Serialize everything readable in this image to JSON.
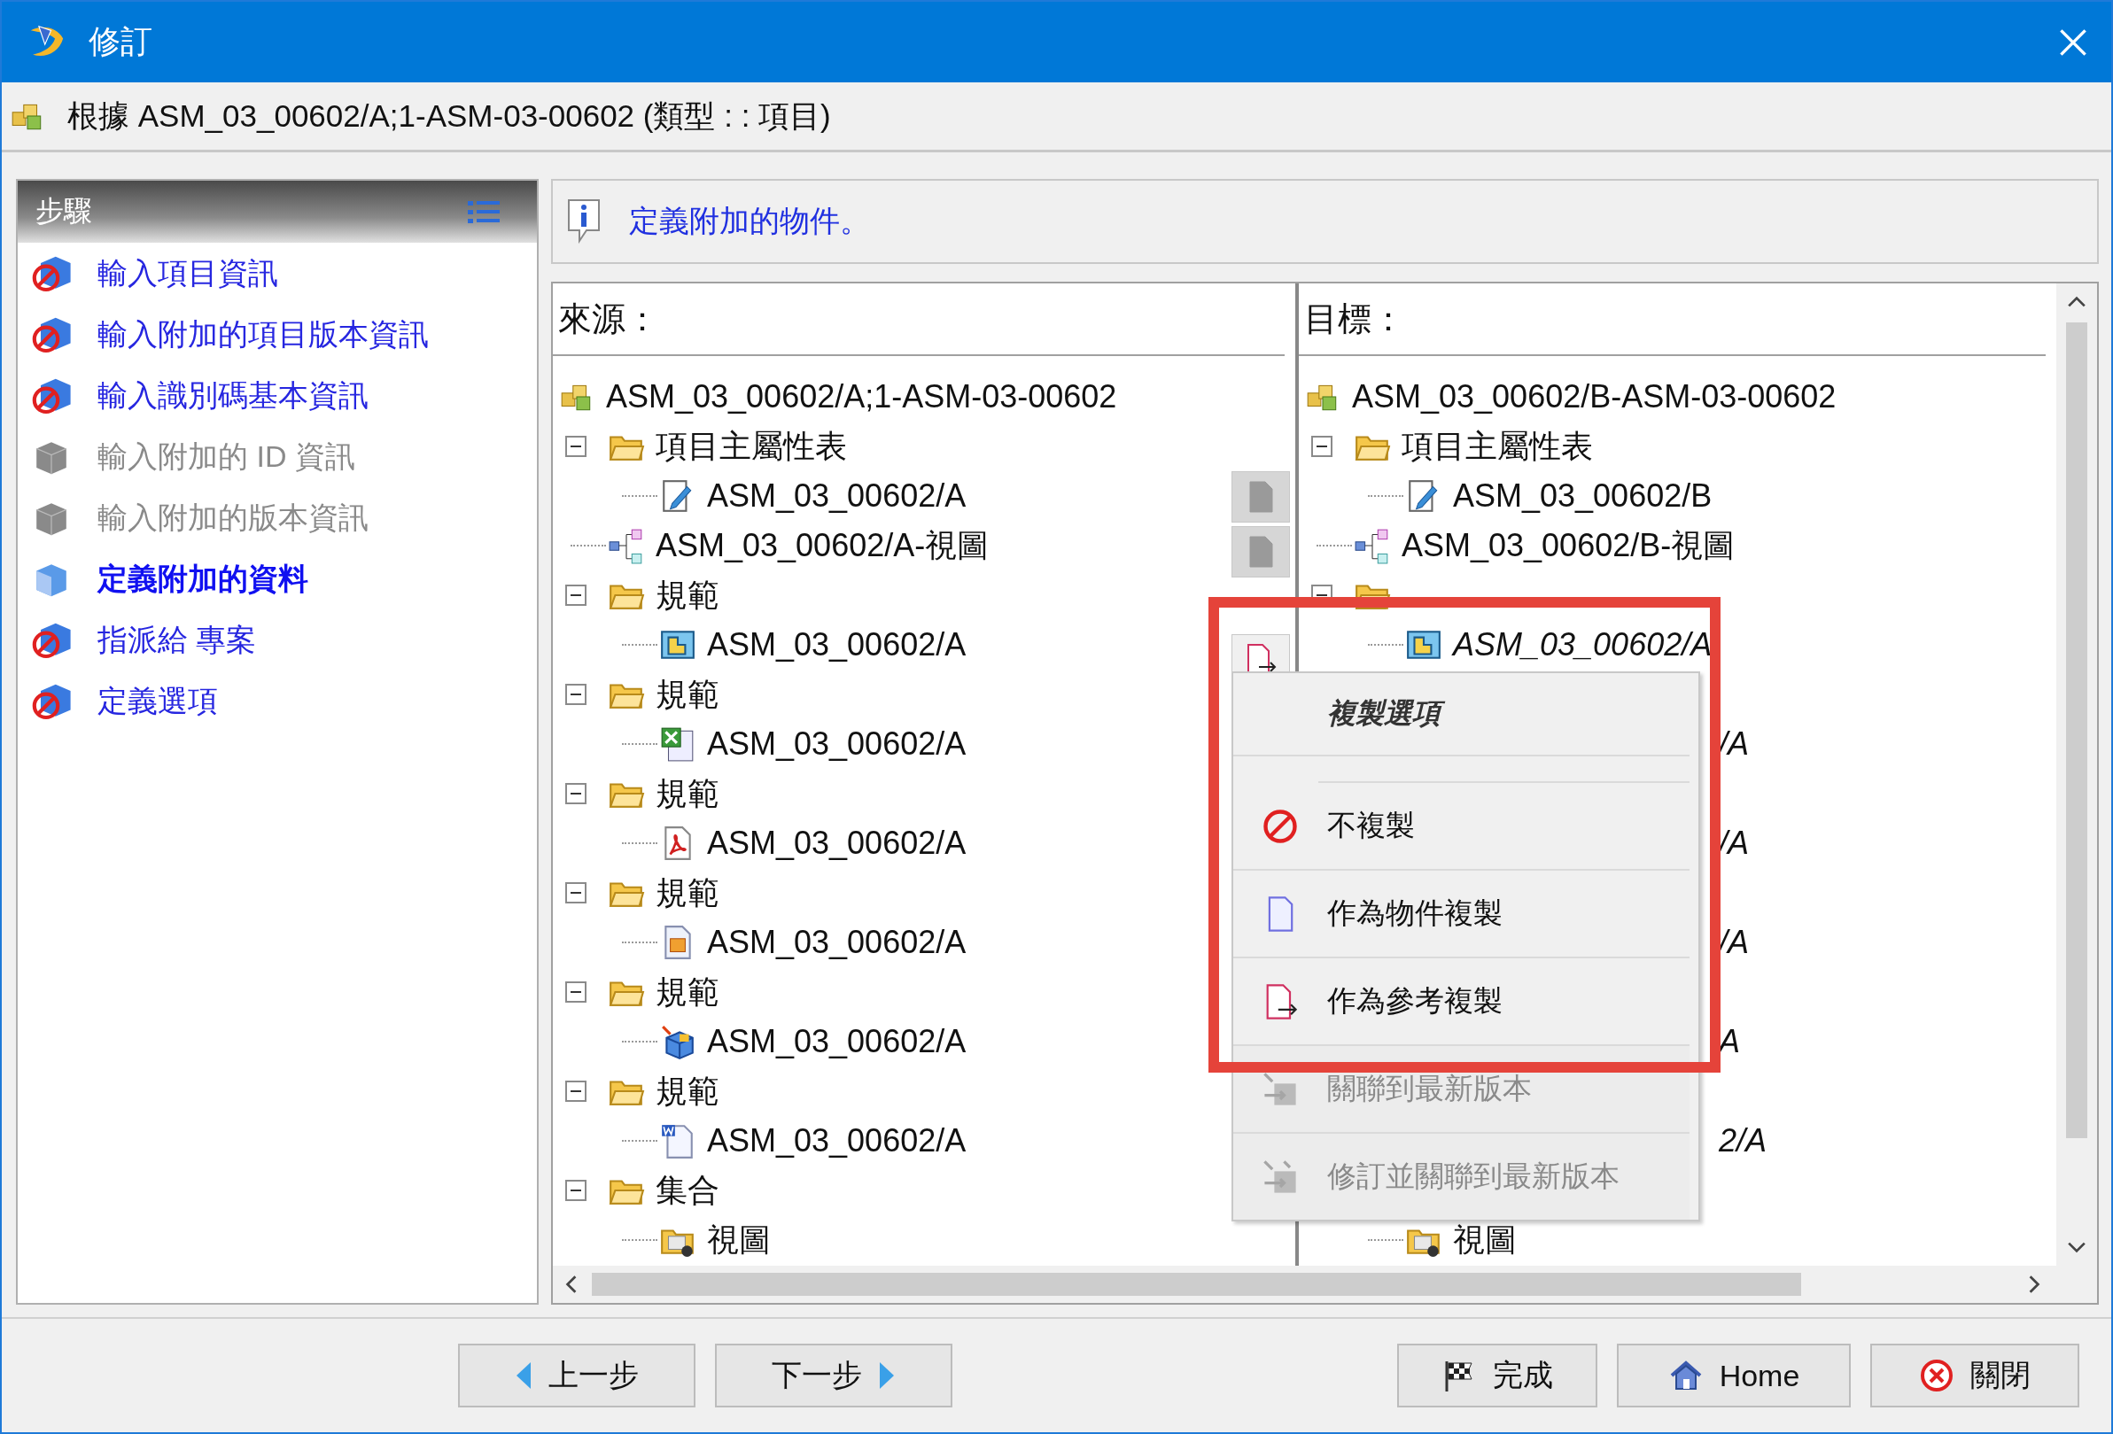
{
  "window": {
    "title": "修訂"
  },
  "subtitle": "根據 ASM_03_00602/A;1-ASM-03-00602 (類型 : : 項目)",
  "steps": {
    "title": "步驟",
    "items": [
      {
        "label": "輸入項目資訊",
        "disabled": false,
        "selected": false
      },
      {
        "label": "輸入附加的項目版本資訊",
        "disabled": false,
        "selected": false
      },
      {
        "label": "輸入識別碼基本資訊",
        "disabled": false,
        "selected": false
      },
      {
        "label": "輸入附加的 ID 資訊",
        "disabled": true,
        "selected": false
      },
      {
        "label": "輸入附加的版本資訊",
        "disabled": true,
        "selected": false
      },
      {
        "label": "定義附加的資料",
        "disabled": false,
        "selected": true
      },
      {
        "label": "指派給 專案",
        "disabled": false,
        "selected": false
      },
      {
        "label": "定義選項",
        "disabled": false,
        "selected": false
      }
    ]
  },
  "info": "定義附加的物件。",
  "source": {
    "title": "來源：",
    "tree": [
      {
        "label": "ASM_03_00602/A;1-ASM-03-00602",
        "kind": "assembly",
        "children": [
          {
            "label": "項目主屬性表",
            "kind": "folder",
            "expanded": true,
            "children": [
              {
                "label": "ASM_03_00602/A",
                "kind": "form"
              }
            ]
          },
          {
            "label": "ASM_03_00602/A-視圖",
            "kind": "view"
          },
          {
            "label": "規範",
            "kind": "folder",
            "expanded": true,
            "children": [
              {
                "label": "ASM_03_00602/A",
                "kind": "drawing"
              }
            ]
          },
          {
            "label": "規範",
            "kind": "folder",
            "expanded": true,
            "children": [
              {
                "label": "ASM_03_00602/A",
                "kind": "excel"
              }
            ]
          },
          {
            "label": "規範",
            "kind": "folder",
            "expanded": true,
            "children": [
              {
                "label": "ASM_03_00602/A",
                "kind": "pdf"
              }
            ]
          },
          {
            "label": "規範",
            "kind": "folder",
            "expanded": true,
            "children": [
              {
                "label": "ASM_03_00602/A",
                "kind": "image"
              }
            ]
          },
          {
            "label": "規範",
            "kind": "folder",
            "expanded": true,
            "children": [
              {
                "label": "ASM_03_00602/A",
                "kind": "part"
              }
            ]
          },
          {
            "label": "規範",
            "kind": "folder",
            "expanded": true,
            "children": [
              {
                "label": "ASM_03_00602/A",
                "kind": "word"
              }
            ]
          },
          {
            "label": "集合",
            "kind": "folder",
            "expanded": true,
            "children": [
              {
                "label": "視圖",
                "kind": "view-folder"
              }
            ]
          }
        ]
      }
    ]
  },
  "transfer_buttons": [
    {
      "kind": "document",
      "disabled": true
    },
    {
      "kind": "document",
      "disabled": true
    },
    {
      "kind": "reference",
      "disabled": false
    }
  ],
  "target": {
    "title": "目標：",
    "tree": [
      {
        "label": "ASM_03_00602/B-ASM-03-00602",
        "kind": "assembly",
        "children": [
          {
            "label": "項目主屬性表",
            "kind": "folder",
            "expanded": true,
            "children": [
              {
                "label": "ASM_03_00602/B",
                "kind": "form"
              }
            ]
          },
          {
            "label": "ASM_03_00602/B-視圖",
            "kind": "view"
          },
          {
            "kind": "folder",
            "expanded": true,
            "children": [
              {
                "label": "ASM_03_00602/A",
                "kind": "drawing",
                "italic": true
              }
            ]
          }
        ]
      }
    ],
    "covered_rows": [
      "/A",
      "/A",
      "/A",
      "A",
      "2/A"
    ],
    "last_row": {
      "label": "視圖",
      "kind": "view-folder"
    }
  },
  "menu": [
    {
      "label": "複製選項",
      "kind": "header"
    },
    {
      "label": "不複製",
      "kind": "no",
      "disabled": false
    },
    {
      "label": "作為物件複製",
      "kind": "object",
      "disabled": false
    },
    {
      "label": "作為參考複製",
      "kind": "reference",
      "disabled": false
    },
    {
      "label": "關聯到最新版本",
      "kind": "link",
      "disabled": true
    },
    {
      "label": "修訂並關聯到最新版本",
      "kind": "revise-link",
      "disabled": true
    }
  ],
  "buttons": [
    {
      "label": "上一步",
      "kind": "prev"
    },
    {
      "label": "下一步",
      "kind": "next"
    },
    {
      "label": "完成",
      "kind": "finish"
    },
    {
      "label": "Home",
      "kind": "home"
    },
    {
      "label": "關閉",
      "kind": "close"
    }
  ]
}
